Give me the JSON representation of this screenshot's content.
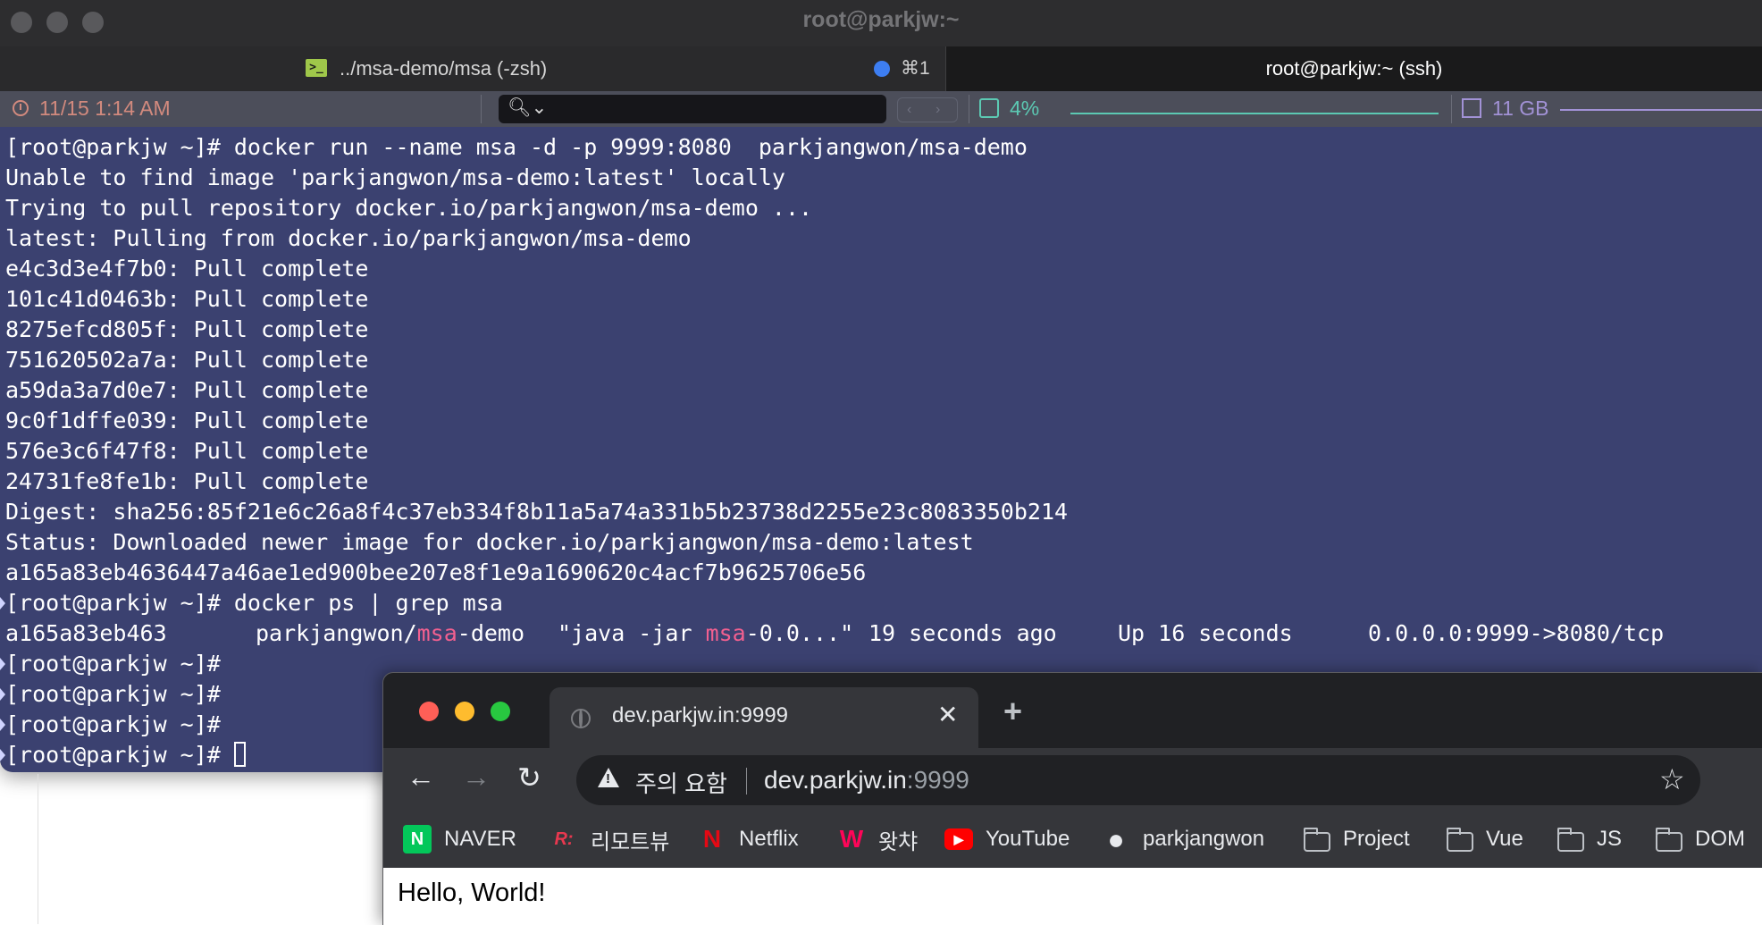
{
  "terminal": {
    "window_title": "root@parkjw:~",
    "tabs": [
      {
        "label": "../msa-demo/msa (-zsh)",
        "shortcut": "⌘1"
      },
      {
        "label": "root@parkjw:~ (ssh)"
      }
    ],
    "status": {
      "time": "11/15 1:14 AM",
      "search_placeholder": "",
      "cpu": "4%",
      "memory": "11 GB"
    },
    "lines": [
      "[root@parkjw ~]# docker run --name msa -d -p 9999:8080  parkjangwon/msa-demo",
      "Unable to find image 'parkjangwon/msa-demo:latest' locally",
      "Trying to pull repository docker.io/parkjangwon/msa-demo ...",
      "latest: Pulling from docker.io/parkjangwon/msa-demo",
      "e4c3d3e4f7b0: Pull complete",
      "101c41d0463b: Pull complete",
      "8275efcd805f: Pull complete",
      "751620502a7a: Pull complete",
      "a59da3a7d0e7: Pull complete",
      "9c0f1dffe039: Pull complete",
      "576e3c6f47f8: Pull complete",
      "24731fe8fe1b: Pull complete",
      "Digest: sha256:85f21e6c26a8f4c37eb334f8b11a5a74a331b5b23738d2255e23c8083350b214",
      "Status: Downloaded newer image for docker.io/parkjangwon/msa-demo:latest",
      "a165a83eb4636447a46ae1ed900bee207e8f1e9a1690620c4acf7b9625706e56",
      "[root@parkjw ~]# docker ps | grep msa"
    ],
    "ps_row": {
      "id": "a165a83eb463",
      "image_pre": "parkjangwon/",
      "image_hl": "msa",
      "image_post": "-demo",
      "cmd_pre": "\"java -jar ",
      "cmd_hl": "msa",
      "cmd_post": "-0.0...\"",
      "created": "19 seconds ago",
      "status": "Up 16 seconds",
      "ports": "0.0.0.0:9999->8080/tcp"
    },
    "prompts": [
      "[root@parkjw ~]#",
      "[root@parkjw ~]#",
      "[root@parkjw ~]#",
      "[root@parkjw ~]# "
    ]
  },
  "browser": {
    "tab_title": "dev.parkjw.in:9999",
    "security_warning": "주의 요함",
    "url_host": "dev.parkjw.in",
    "url_port": ":9999",
    "bookmarks": [
      {
        "label": "NAVER",
        "icon": "naver-icon",
        "glyph": "N",
        "color": "#03c75a"
      },
      {
        "label": "리모트뷰",
        "icon": "remoteview-icon",
        "glyph": "R:",
        "color": "#e8384f"
      },
      {
        "label": "Netflix",
        "icon": "netflix-icon",
        "glyph": "N",
        "color": "#e50914"
      },
      {
        "label": "왓챠",
        "icon": "watcha-icon",
        "glyph": "W",
        "color": "#ff0558"
      },
      {
        "label": "YouTube",
        "icon": "youtube-icon",
        "glyph": "▶",
        "color": "#ff0000"
      },
      {
        "label": "parkjangwon",
        "icon": "github-icon",
        "glyph": "●",
        "color": "#e8eaed"
      },
      {
        "label": "Project",
        "icon": "folder-icon"
      },
      {
        "label": "Vue",
        "icon": "folder-icon"
      },
      {
        "label": "JS",
        "icon": "folder-icon"
      },
      {
        "label": "DOM",
        "icon": "folder-icon"
      }
    ],
    "page_text": "Hello, World!"
  }
}
